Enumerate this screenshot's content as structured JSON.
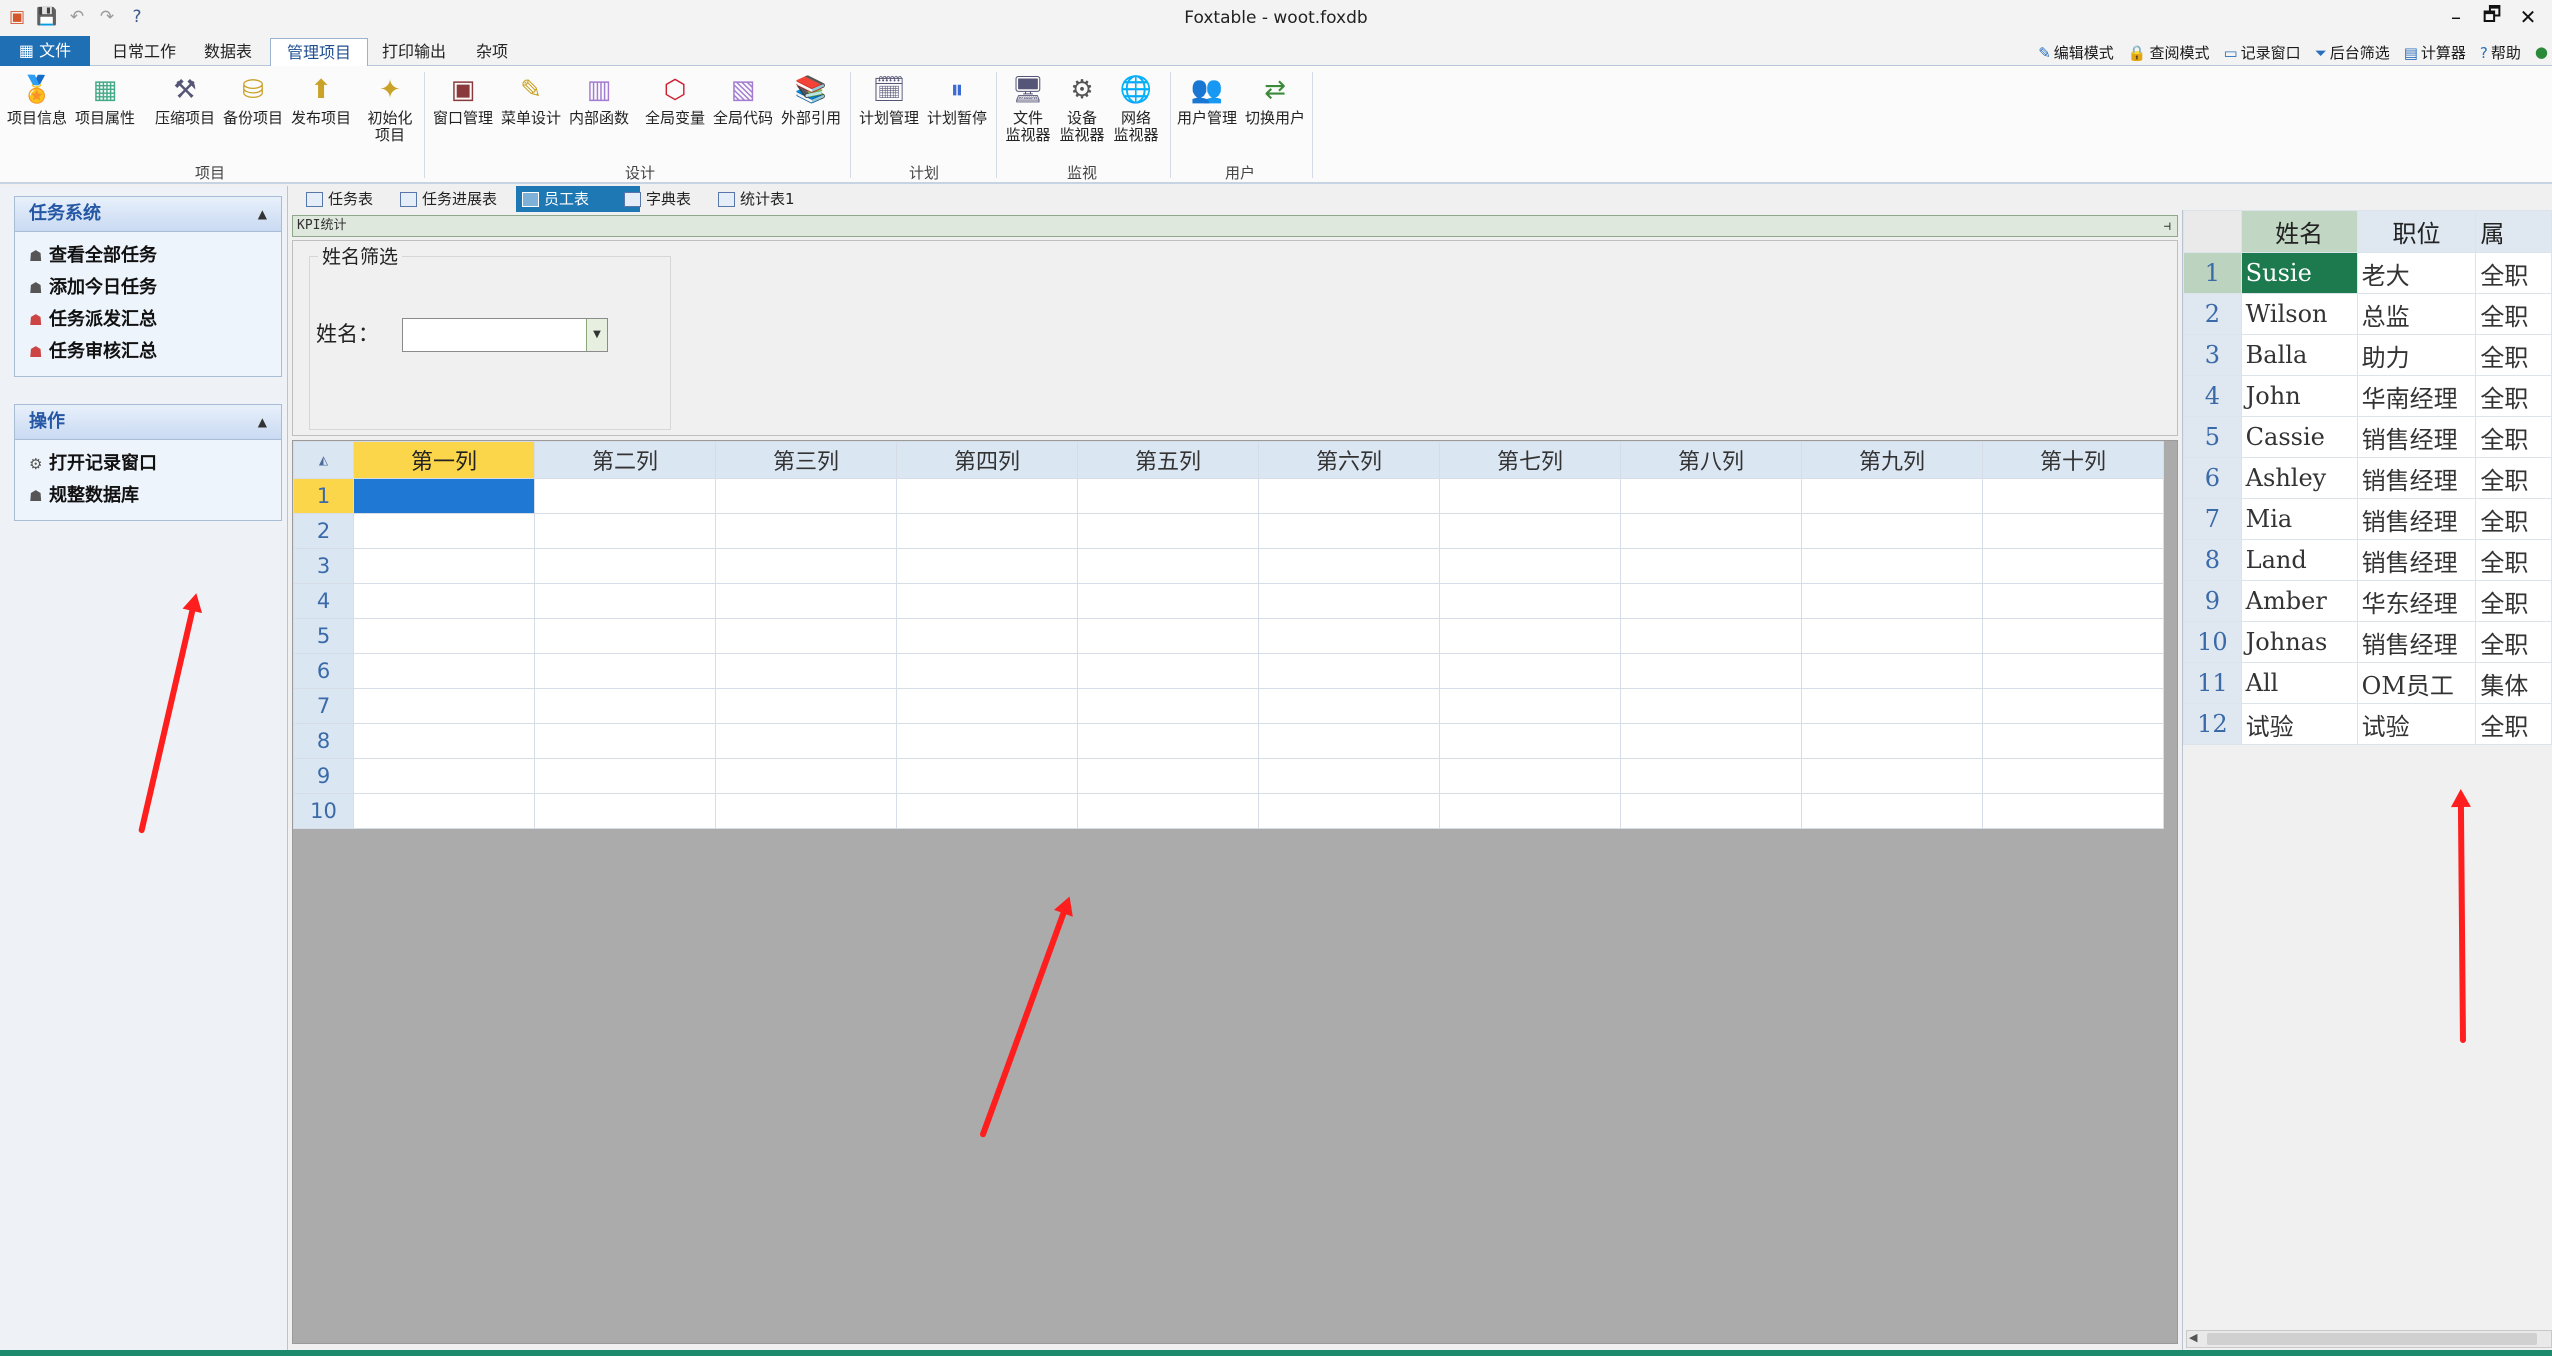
{
  "window": {
    "title": "Foxtable - woot.foxdb",
    "qat_icons": [
      "app-icon",
      "save-icon",
      "undo-icon",
      "redo-icon",
      "help-icon"
    ],
    "controls": {
      "minimize": "–",
      "restore": "🗗",
      "close": "✕"
    }
  },
  "ribbon_tabs": [
    "文件",
    "日常工作",
    "数据表",
    "管理项目",
    "打印输出",
    "杂项"
  ],
  "ribbon_active_tab": "管理项目",
  "right_links": [
    "编辑模式",
    "查阅模式",
    "记录窗口",
    "后台筛选",
    "计算器",
    "帮助"
  ],
  "ribbon_groups": [
    {
      "name": "项目",
      "buttons": [
        "项目信息",
        "项目属性",
        "压缩项目",
        "备份项目",
        "发布项目",
        "初始化\n项目"
      ]
    },
    {
      "name": "设计",
      "buttons": [
        "窗口管理",
        "菜单设计",
        "内部函数",
        "全局变量",
        "全局代码",
        "外部引用"
      ]
    },
    {
      "name": "计划",
      "buttons": [
        "计划管理",
        "计划暂停"
      ]
    },
    {
      "name": "监视",
      "buttons": [
        "文件\n监视器",
        "设备\n监视器",
        "网络\n监视器"
      ]
    },
    {
      "name": "用户",
      "buttons": [
        "用户管理",
        "切换用户"
      ]
    }
  ],
  "sidebar": {
    "sections": [
      {
        "title": "任务系统",
        "items": [
          "查看全部任务",
          "添加今日任务",
          "任务派发汇总",
          "任务审核汇总"
        ]
      },
      {
        "title": "操作",
        "items": [
          "打开记录窗口",
          "规整数据库"
        ]
      }
    ]
  },
  "doc_tabs": [
    "任务表",
    "任务进展表",
    "员工表",
    "字典表",
    "统计表1"
  ],
  "doc_active_tab": "员工表",
  "kpi": {
    "bar_title": "KPI统计",
    "filter_group_title": "姓名筛选",
    "name_label": "姓名：",
    "name_value": ""
  },
  "main_grid": {
    "columns": [
      "第一列",
      "第二列",
      "第三列",
      "第四列",
      "第五列",
      "第六列",
      "第七列",
      "第八列",
      "第九列",
      "第十列"
    ],
    "row_numbers": [
      "1",
      "2",
      "3",
      "4",
      "5",
      "6",
      "7",
      "8",
      "9",
      "10"
    ]
  },
  "employee_table": {
    "columns": [
      "姓名",
      "职位",
      "属"
    ],
    "rows": [
      [
        "1",
        "Susie",
        "老大",
        "全职"
      ],
      [
        "2",
        "Wilson",
        "总监",
        "全职"
      ],
      [
        "3",
        "Balla",
        "助力",
        "全职"
      ],
      [
        "4",
        "John",
        "华南经理",
        "全职"
      ],
      [
        "5",
        "Cassie",
        "销售经理",
        "全职"
      ],
      [
        "6",
        "Ashley",
        "销售经理",
        "全职"
      ],
      [
        "7",
        "Mia",
        "销售经理",
        "全职"
      ],
      [
        "8",
        "Land",
        "销售经理",
        "全职"
      ],
      [
        "9",
        "Amber",
        "华东经理",
        "全职"
      ],
      [
        "10",
        "Johnas",
        "销售经理",
        "全职"
      ],
      [
        "11",
        "All",
        "OM员工",
        "集体"
      ],
      [
        "12",
        "试验",
        "试验",
        "全职"
      ]
    ]
  },
  "colors": {
    "accent": "#1e78b4",
    "selection": "#fbd54a",
    "arrow": "#ff1e1e",
    "current_cell_right": "#1c7a4e"
  }
}
